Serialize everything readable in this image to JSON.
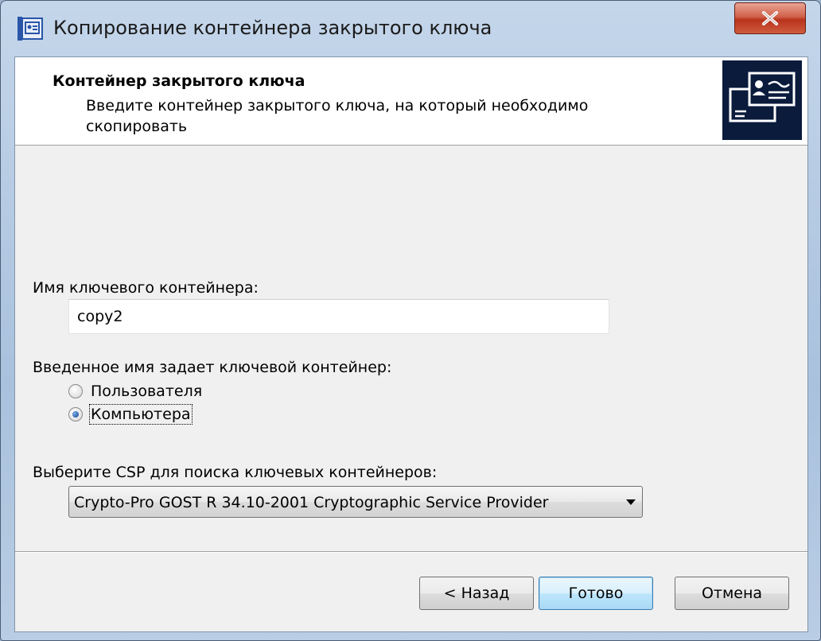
{
  "window": {
    "title": "Копирование контейнера закрытого ключа",
    "close_icon": "close-x-icon"
  },
  "header": {
    "title": "Контейнер закрытого ключа",
    "description": "Введите контейнер закрытого ключа, на который необходимо скопировать",
    "image_icon": "certificate-cards-icon"
  },
  "form": {
    "container_name_label": "Имя ключевого контейнера:",
    "container_name_value": "copy2",
    "scope_label": "Введенное имя задает ключевой контейнер:",
    "scope_options": [
      {
        "label": "Пользователя",
        "checked": false
      },
      {
        "label": "Компьютера",
        "checked": true
      }
    ],
    "csp_label": "Выберите CSP для поиска ключевых контейнеров:",
    "csp_selected": "Crypto-Pro GOST R 34.10-2001 Cryptographic Service Provider"
  },
  "buttons": {
    "back": "< Назад",
    "finish": "Готово",
    "cancel": "Отмена"
  },
  "colors": {
    "close_button": "#c8452c",
    "default_button_border": "#3c7fb1",
    "header_image_bg": "#0a1b3c"
  }
}
